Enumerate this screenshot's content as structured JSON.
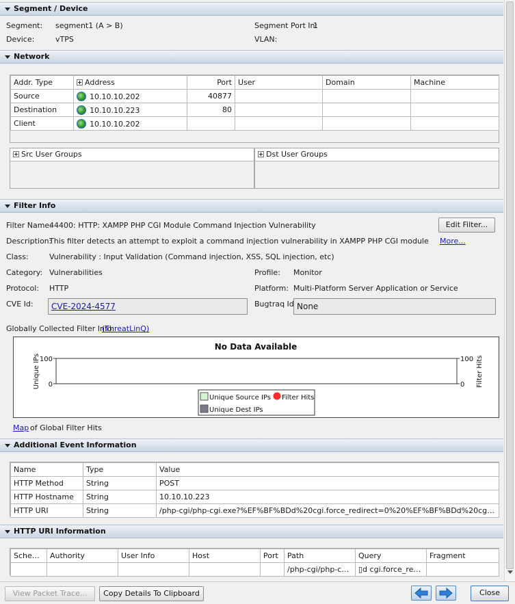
{
  "segment_device": {
    "title": "Segment / Device",
    "segment_label": "Segment:",
    "segment_value": "segment1 (A > B)",
    "segment_port_label": "Segment Port In:",
    "segment_port_value": "1",
    "device_label": "Device:",
    "device_value": "vTPS",
    "vlan_label": "VLAN:",
    "vlan_value": ""
  },
  "network": {
    "title": "Network",
    "columns": [
      "Addr. Type",
      "Address",
      "Port",
      "User",
      "Domain",
      "Machine"
    ],
    "rows": [
      {
        "type": "Source",
        "address": "10.10.10.202",
        "port": "40877",
        "user": "",
        "domain": "",
        "machine": ""
      },
      {
        "type": "Destination",
        "address": "10.10.10.223",
        "port": "80",
        "user": "",
        "domain": "",
        "machine": ""
      },
      {
        "type": "Client",
        "address": "10.10.10.202",
        "port": "",
        "user": "",
        "domain": "",
        "machine": ""
      }
    ],
    "src_groups_label": "Src User Groups",
    "dst_groups_label": "Dst User Groups"
  },
  "filter_info": {
    "title": "Filter Info",
    "filter_name_label": "Filter Name:",
    "filter_name_value": "44400: HTTP: XAMPP PHP CGI Module Command Injection Vulnerability",
    "edit_filter_button": "Edit Filter...",
    "description_label": "Description:",
    "description_value": "This filter detects an attempt to exploit a command injection vulnerability in XAMPP PHP CGI module operating on Wind",
    "more_link": "More...",
    "class_label": "Class:",
    "class_value": "Vulnerability : Input Validation (Command injection, XSS, SQL injection, etc)",
    "category_label": "Category:",
    "category_value": "Vulnerabilities",
    "profile_label": "Profile:",
    "profile_value": "Monitor",
    "protocol_label": "Protocol:",
    "protocol_value": "HTTP",
    "platform_label": "Platform:",
    "platform_value": "Multi-Platform Server Application or Service",
    "cve_label": "CVE Id:",
    "cve_value": "CVE-2024-4577",
    "bugtraq_label": "Bugtraq Id:",
    "bugtraq_value": "None",
    "global_label": "Globally Collected Filter Info:",
    "threatlinq_link": "(ThreatLinQ)",
    "map_link": "Map",
    "map_suffix": "of Global Filter Hits"
  },
  "chart_data": {
    "type": "line",
    "title": "No Data Available",
    "ylabel": "Unique IPs",
    "y2label": "Filter Hits",
    "ylim": [
      0,
      100
    ],
    "y2lim": [
      0,
      100
    ],
    "y_ticks": [
      "100",
      "0"
    ],
    "y2_ticks": [
      "100",
      "0"
    ],
    "x": [],
    "series": [
      {
        "name": "Unique Source IPs",
        "values": [],
        "color": "#d4f5d4"
      },
      {
        "name": "Filter Hits",
        "values": [],
        "color": "#ff2a2a"
      },
      {
        "name": "Unique Dest IPs",
        "values": [],
        "color": "#7a7a8c"
      }
    ],
    "legend": "bottom-center"
  },
  "additional_info": {
    "title": "Additional Event Information",
    "columns": [
      "Name",
      "Type",
      "Value"
    ],
    "rows": [
      {
        "name": "HTTP Method",
        "type": "String",
        "value": "POST"
      },
      {
        "name": "HTTP Hostname",
        "type": "String",
        "value": "10.10.10.223"
      },
      {
        "name": "HTTP URI",
        "type": "String",
        "value": "/php-cgi/php-cgi.exe?%EF%BF%BDd%20cgi.force_redirect=0%20%EF%BF%BDd%20cgi.redirect_..."
      }
    ]
  },
  "http_uri": {
    "title": "HTTP URI Information",
    "columns": [
      "Scheme",
      "Authority",
      "User Info",
      "Host",
      "Port",
      "Path",
      "Query",
      "Fragment"
    ],
    "row": [
      "",
      "",
      "",
      "",
      "",
      "/php-cgi/php-cgi.e...",
      "▯d cgi.force_redir...",
      ""
    ]
  },
  "footer": {
    "view_packet_trace": "View Packet Trace...",
    "copy_details": "Copy Details To Clipboard",
    "close": "Close"
  },
  "icons": {
    "back": "arrow-left-icon",
    "forward": "arrow-right-icon",
    "address": "globe-icon"
  },
  "colors": {
    "section_header": "#c9d5e3",
    "link": "#1a1aa8",
    "nav_arrow": "#2f7fd6",
    "filter_hits_dot": "#ff2a2a"
  }
}
